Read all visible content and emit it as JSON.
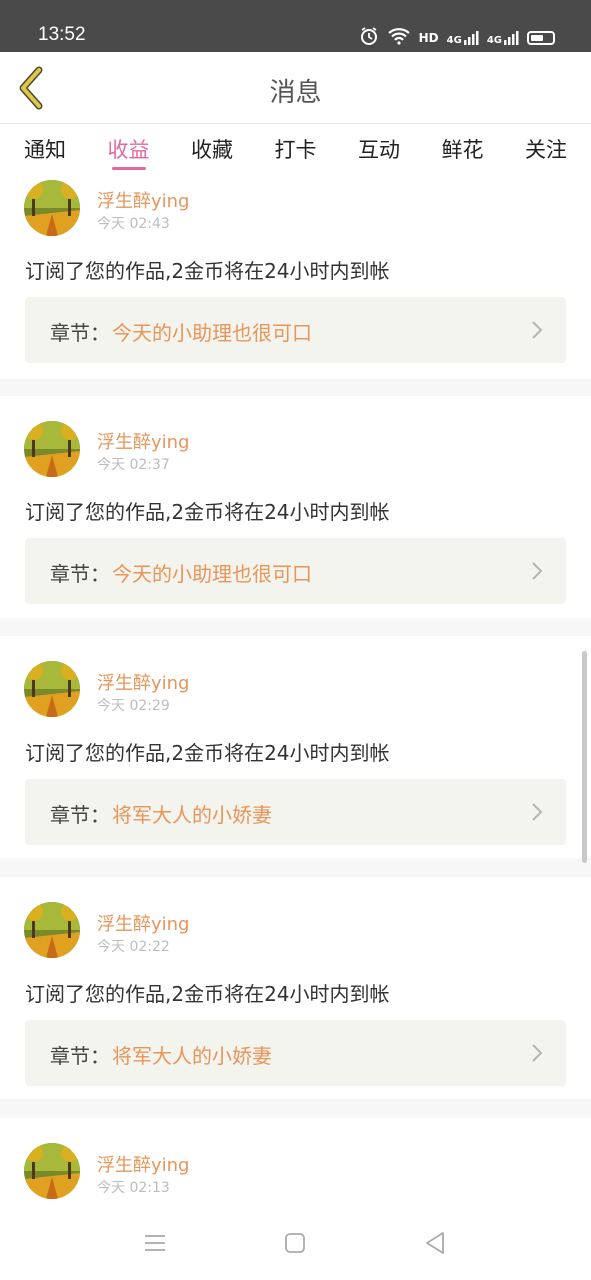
{
  "status_bar": {
    "time": "13:52",
    "icons": [
      "alarm-icon",
      "wifi-icon",
      "hd-icon",
      "signal-4g-icon",
      "signal-4g-icon",
      "battery-icon"
    ],
    "hd_label": "HD",
    "net1": "4G",
    "net2": "4G"
  },
  "header": {
    "title": "消息",
    "back_icon": "back-chevron-icon",
    "accent": "#e0c64a"
  },
  "tabs": [
    {
      "label": "通知",
      "active": false
    },
    {
      "label": "收益",
      "active": true
    },
    {
      "label": "收藏",
      "active": false
    },
    {
      "label": "打卡",
      "active": false
    },
    {
      "label": "互动",
      "active": false
    },
    {
      "label": "鲜花",
      "active": false
    },
    {
      "label": "关注",
      "active": false
    }
  ],
  "colors": {
    "active_tab": "#e06a9b",
    "username": "#e8955a",
    "chapter_bg": "#f4f4ee"
  },
  "messages": [
    {
      "username": "浮生醉ying",
      "time": "今天 02:43",
      "text": "订阅了您的作品,2金币将在24小时内到帐",
      "chapter_label": "章节：",
      "chapter_title": "今天的小助理也很可口"
    },
    {
      "username": "浮生醉ying",
      "time": "今天 02:37",
      "text": "订阅了您的作品,2金币将在24小时内到帐",
      "chapter_label": "章节：",
      "chapter_title": "今天的小助理也很可口"
    },
    {
      "username": "浮生醉ying",
      "time": "今天 02:29",
      "text": "订阅了您的作品,2金币将在24小时内到帐",
      "chapter_label": "章节：",
      "chapter_title": "将军大人的小娇妻"
    },
    {
      "username": "浮生醉ying",
      "time": "今天 02:22",
      "text": "订阅了您的作品,2金币将在24小时内到帐",
      "chapter_label": "章节：",
      "chapter_title": "将军大人的小娇妻"
    },
    {
      "username": "浮生醉ying",
      "time": "今天 02:13"
    }
  ],
  "bottom_nav": [
    "menu-icon",
    "home-icon",
    "back-triangle-icon"
  ]
}
